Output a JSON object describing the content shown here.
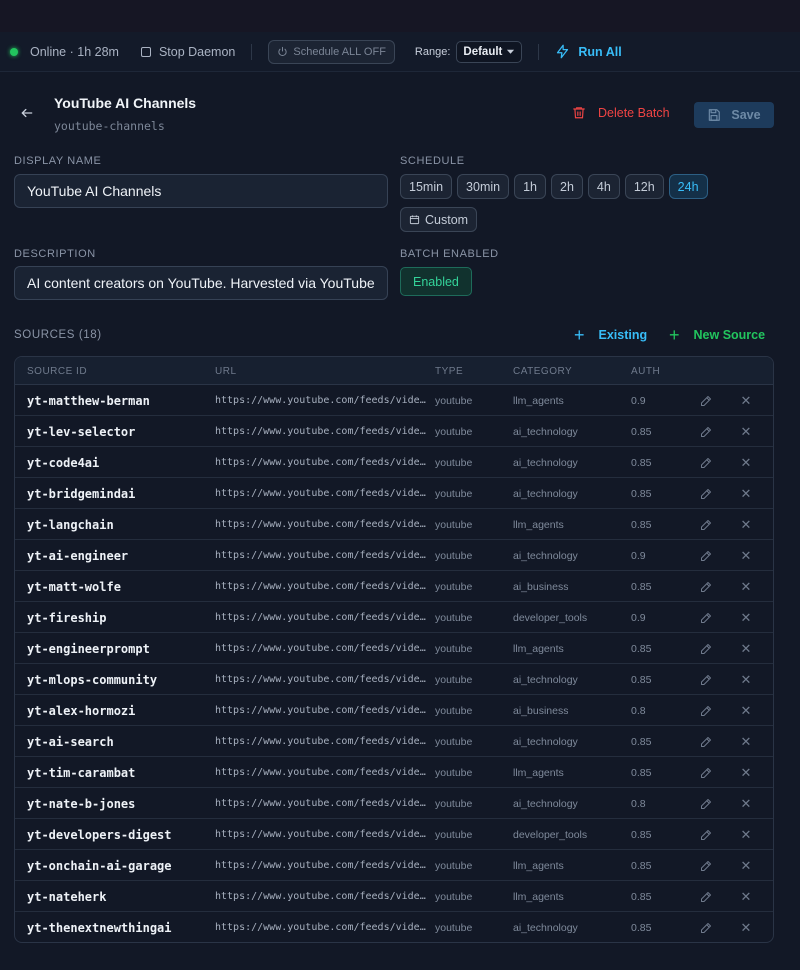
{
  "toolbar": {
    "status": "Online · 1h 28m",
    "stop_daemon": "Stop Daemon",
    "schedule_all_off": "Schedule ALL OFF",
    "range_label": "Range:",
    "range_value": "Default",
    "run_all": "Run All"
  },
  "header": {
    "title": "YouTube AI Channels",
    "slug": "youtube-channels",
    "delete_batch": "Delete Batch",
    "save": "Save"
  },
  "form": {
    "display_name_label": "DISPLAY NAME",
    "display_name_value": "YouTube AI Channels",
    "description_label": "DESCRIPTION",
    "description_value": "AI content creators on YouTube. Harvested via YouTube",
    "schedule_label": "SCHEDULE",
    "schedule_options": [
      "15min",
      "30min",
      "1h",
      "2h",
      "4h",
      "12h",
      "24h"
    ],
    "schedule_selected": "24h",
    "schedule_custom": "Custom",
    "batch_enabled_label": "BATCH ENABLED",
    "batch_enabled_value": "Enabled"
  },
  "sources": {
    "label": "SOURCES (18)",
    "existing": "Existing",
    "new_source": "New Source",
    "columns": [
      "SOURCE ID",
      "URL",
      "TYPE",
      "CATEGORY",
      "AUTH"
    ],
    "rows": [
      {
        "id": "yt-matthew-berman",
        "url": "https://www.youtube.com/feeds/videos.xml",
        "type": "youtube",
        "category": "llm_agents",
        "auth": "0.9"
      },
      {
        "id": "yt-lev-selector",
        "url": "https://www.youtube.com/feeds/videos.xml",
        "type": "youtube",
        "category": "ai_technology",
        "auth": "0.85"
      },
      {
        "id": "yt-code4ai",
        "url": "https://www.youtube.com/feeds/videos.xml",
        "type": "youtube",
        "category": "ai_technology",
        "auth": "0.85"
      },
      {
        "id": "yt-bridgemindai",
        "url": "https://www.youtube.com/feeds/videos.xml",
        "type": "youtube",
        "category": "ai_technology",
        "auth": "0.85"
      },
      {
        "id": "yt-langchain",
        "url": "https://www.youtube.com/feeds/videos.xml",
        "type": "youtube",
        "category": "llm_agents",
        "auth": "0.85"
      },
      {
        "id": "yt-ai-engineer",
        "url": "https://www.youtube.com/feeds/videos.xml",
        "type": "youtube",
        "category": "ai_technology",
        "auth": "0.9"
      },
      {
        "id": "yt-matt-wolfe",
        "url": "https://www.youtube.com/feeds/videos.xml",
        "type": "youtube",
        "category": "ai_business",
        "auth": "0.85"
      },
      {
        "id": "yt-fireship",
        "url": "https://www.youtube.com/feeds/videos.xml",
        "type": "youtube",
        "category": "developer_tools",
        "auth": "0.9"
      },
      {
        "id": "yt-engineerprompt",
        "url": "https://www.youtube.com/feeds/videos.xml",
        "type": "youtube",
        "category": "llm_agents",
        "auth": "0.85"
      },
      {
        "id": "yt-mlops-community",
        "url": "https://www.youtube.com/feeds/videos.xml",
        "type": "youtube",
        "category": "ai_technology",
        "auth": "0.85"
      },
      {
        "id": "yt-alex-hormozi",
        "url": "https://www.youtube.com/feeds/videos.xml",
        "type": "youtube",
        "category": "ai_business",
        "auth": "0.8"
      },
      {
        "id": "yt-ai-search",
        "url": "https://www.youtube.com/feeds/videos.xml",
        "type": "youtube",
        "category": "ai_technology",
        "auth": "0.85"
      },
      {
        "id": "yt-tim-carambat",
        "url": "https://www.youtube.com/feeds/videos.xml",
        "type": "youtube",
        "category": "llm_agents",
        "auth": "0.85"
      },
      {
        "id": "yt-nate-b-jones",
        "url": "https://www.youtube.com/feeds/videos.xml",
        "type": "youtube",
        "category": "ai_technology",
        "auth": "0.8"
      },
      {
        "id": "yt-developers-digest",
        "url": "https://www.youtube.com/feeds/videos.xml",
        "type": "youtube",
        "category": "developer_tools",
        "auth": "0.85"
      },
      {
        "id": "yt-onchain-ai-garage",
        "url": "https://www.youtube.com/feeds/videos.xml",
        "type": "youtube",
        "category": "llm_agents",
        "auth": "0.85"
      },
      {
        "id": "yt-nateherk",
        "url": "https://www.youtube.com/feeds/videos.xml",
        "type": "youtube",
        "category": "llm_agents",
        "auth": "0.85"
      },
      {
        "id": "yt-thenextnewthingai",
        "url": "https://www.youtube.com/feeds/videos.xml",
        "type": "youtube",
        "category": "ai_technology",
        "auth": "0.85"
      }
    ]
  },
  "colors": {
    "background": "#121826",
    "accent_blue": "#38bdf8",
    "success_green": "#22c55e",
    "danger_red": "#ef4444"
  },
  "icons": {
    "status": "status-dot-icon",
    "stop": "checkbox-icon",
    "schedule_off": "power-icon",
    "range": "chevron-down-icon",
    "run_all": "lightning-icon",
    "back": "arrow-left-icon",
    "delete": "trash-icon",
    "save": "floppy-disk-icon",
    "custom": "calendar-icon",
    "add": "plus-icon",
    "edit": "pencil-icon",
    "remove": "close-icon"
  }
}
